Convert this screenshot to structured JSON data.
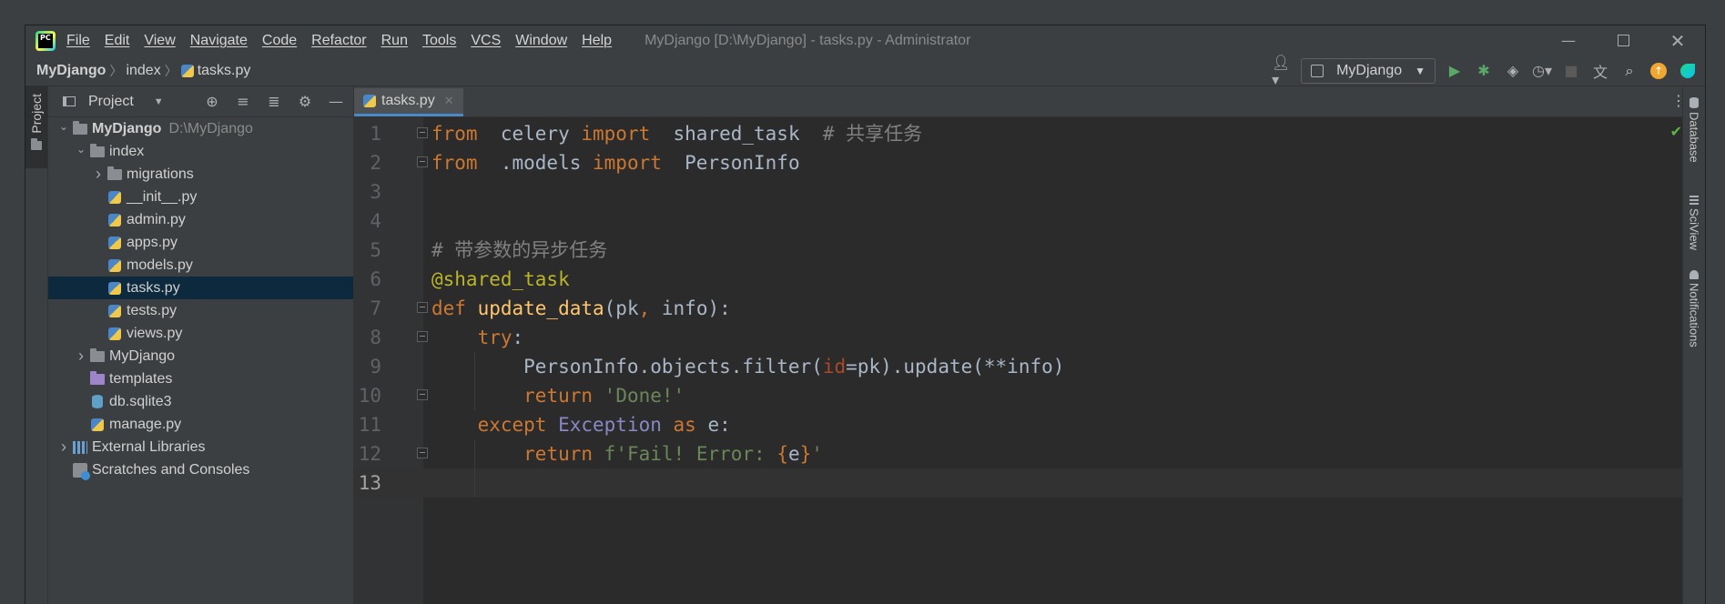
{
  "app": {
    "logo_text": "PC",
    "window_title": "MyDjango [D:\\MyDjango] - tasks.py - Administrator",
    "menu": [
      "File",
      "Edit",
      "View",
      "Navigate",
      "Code",
      "Refactor",
      "Run",
      "Tools",
      "VCS",
      "Window",
      "Help"
    ]
  },
  "breadcrumb": {
    "project": "MyDjango",
    "folder": "index",
    "file": "tasks.py"
  },
  "toolbar": {
    "run_config": "MyDjango"
  },
  "left_stripe": {
    "project_tab": "Project"
  },
  "project_panel": {
    "title": "Project",
    "tree": [
      {
        "label": "MyDjango",
        "hint": "D:\\MyDjango",
        "icon": "folder-icon",
        "level": 0,
        "expanded": true,
        "bold": true
      },
      {
        "label": "index",
        "icon": "folder-icon",
        "level": 1,
        "expanded": true
      },
      {
        "label": "migrations",
        "icon": "folder-icon",
        "level": 2,
        "expanded": false
      },
      {
        "label": "__init__.py",
        "icon": "python-file-icon",
        "level": 2
      },
      {
        "label": "admin.py",
        "icon": "python-file-icon",
        "level": 2
      },
      {
        "label": "apps.py",
        "icon": "python-file-icon",
        "level": 2
      },
      {
        "label": "models.py",
        "icon": "python-file-icon",
        "level": 2
      },
      {
        "label": "tasks.py",
        "icon": "python-file-icon",
        "level": 2,
        "selected": true
      },
      {
        "label": "tests.py",
        "icon": "python-file-icon",
        "level": 2
      },
      {
        "label": "views.py",
        "icon": "python-file-icon",
        "level": 2
      },
      {
        "label": "MyDjango",
        "icon": "folder-icon",
        "level": 1,
        "expanded": false
      },
      {
        "label": "templates",
        "icon": "template-folder-icon",
        "level": 1
      },
      {
        "label": "db.sqlite3",
        "icon": "database-file-icon",
        "level": 1
      },
      {
        "label": "manage.py",
        "icon": "python-file-icon",
        "level": 1
      },
      {
        "label": "External Libraries",
        "icon": "libraries-icon",
        "level": 0,
        "expanded": false
      },
      {
        "label": "Scratches and Consoles",
        "icon": "scratches-icon",
        "level": 0
      }
    ]
  },
  "editor": {
    "tab_label": "tasks.py",
    "current_line": 13,
    "lines": [
      {
        "n": "1",
        "tokens": [
          [
            "kw",
            "from"
          ],
          [
            "",
            "  celery "
          ],
          [
            "kw",
            "import"
          ],
          [
            "",
            "  shared_task  "
          ],
          [
            "cm",
            "# 共享任务"
          ]
        ]
      },
      {
        "n": "2",
        "tokens": [
          [
            "kw",
            "from"
          ],
          [
            "",
            "  .models "
          ],
          [
            "kw",
            "import"
          ],
          [
            "",
            "  PersonInfo"
          ]
        ]
      },
      {
        "n": "3",
        "tokens": []
      },
      {
        "n": "4",
        "tokens": []
      },
      {
        "n": "5",
        "tokens": [
          [
            "cm",
            "# 带参数的异步任务"
          ]
        ]
      },
      {
        "n": "6",
        "tokens": [
          [
            "dec",
            "@shared_task"
          ]
        ]
      },
      {
        "n": "7",
        "tokens": [
          [
            "kw",
            "def "
          ],
          [
            "fn",
            "update_data"
          ],
          [
            "",
            "(pk"
          ],
          [
            "kw",
            ","
          ],
          [
            "",
            " info):"
          ]
        ]
      },
      {
        "n": "8",
        "tokens": [
          [
            "",
            "    "
          ],
          [
            "kw",
            "try"
          ],
          [
            "",
            ":"
          ]
        ]
      },
      {
        "n": "9",
        "tokens": [
          [
            "",
            "        PersonInfo.objects.filter("
          ],
          [
            "param",
            "id"
          ],
          [
            "",
            "=pk).update(**info)"
          ]
        ]
      },
      {
        "n": "10",
        "tokens": [
          [
            "",
            "        "
          ],
          [
            "kw",
            "return "
          ],
          [
            "st",
            "'Done!'"
          ]
        ]
      },
      {
        "n": "11",
        "tokens": [
          [
            "",
            "    "
          ],
          [
            "kw",
            "except "
          ],
          [
            "bi",
            "Exception "
          ],
          [
            "kw",
            "as "
          ],
          [
            "",
            "e:"
          ]
        ]
      },
      {
        "n": "12",
        "tokens": [
          [
            "",
            "        "
          ],
          [
            "kw",
            "return "
          ],
          [
            "st",
            "f'Fail! Error: "
          ],
          [
            "kw",
            "{"
          ],
          [
            "",
            "e"
          ],
          [
            "kw",
            "}"
          ],
          [
            "st",
            "'"
          ]
        ]
      },
      {
        "n": "13",
        "tokens": []
      }
    ],
    "fold_markers": [
      1,
      2,
      7,
      8,
      10,
      12
    ]
  },
  "right_stripe": {
    "tabs": [
      "Database",
      "SciView",
      "Notifications"
    ]
  }
}
